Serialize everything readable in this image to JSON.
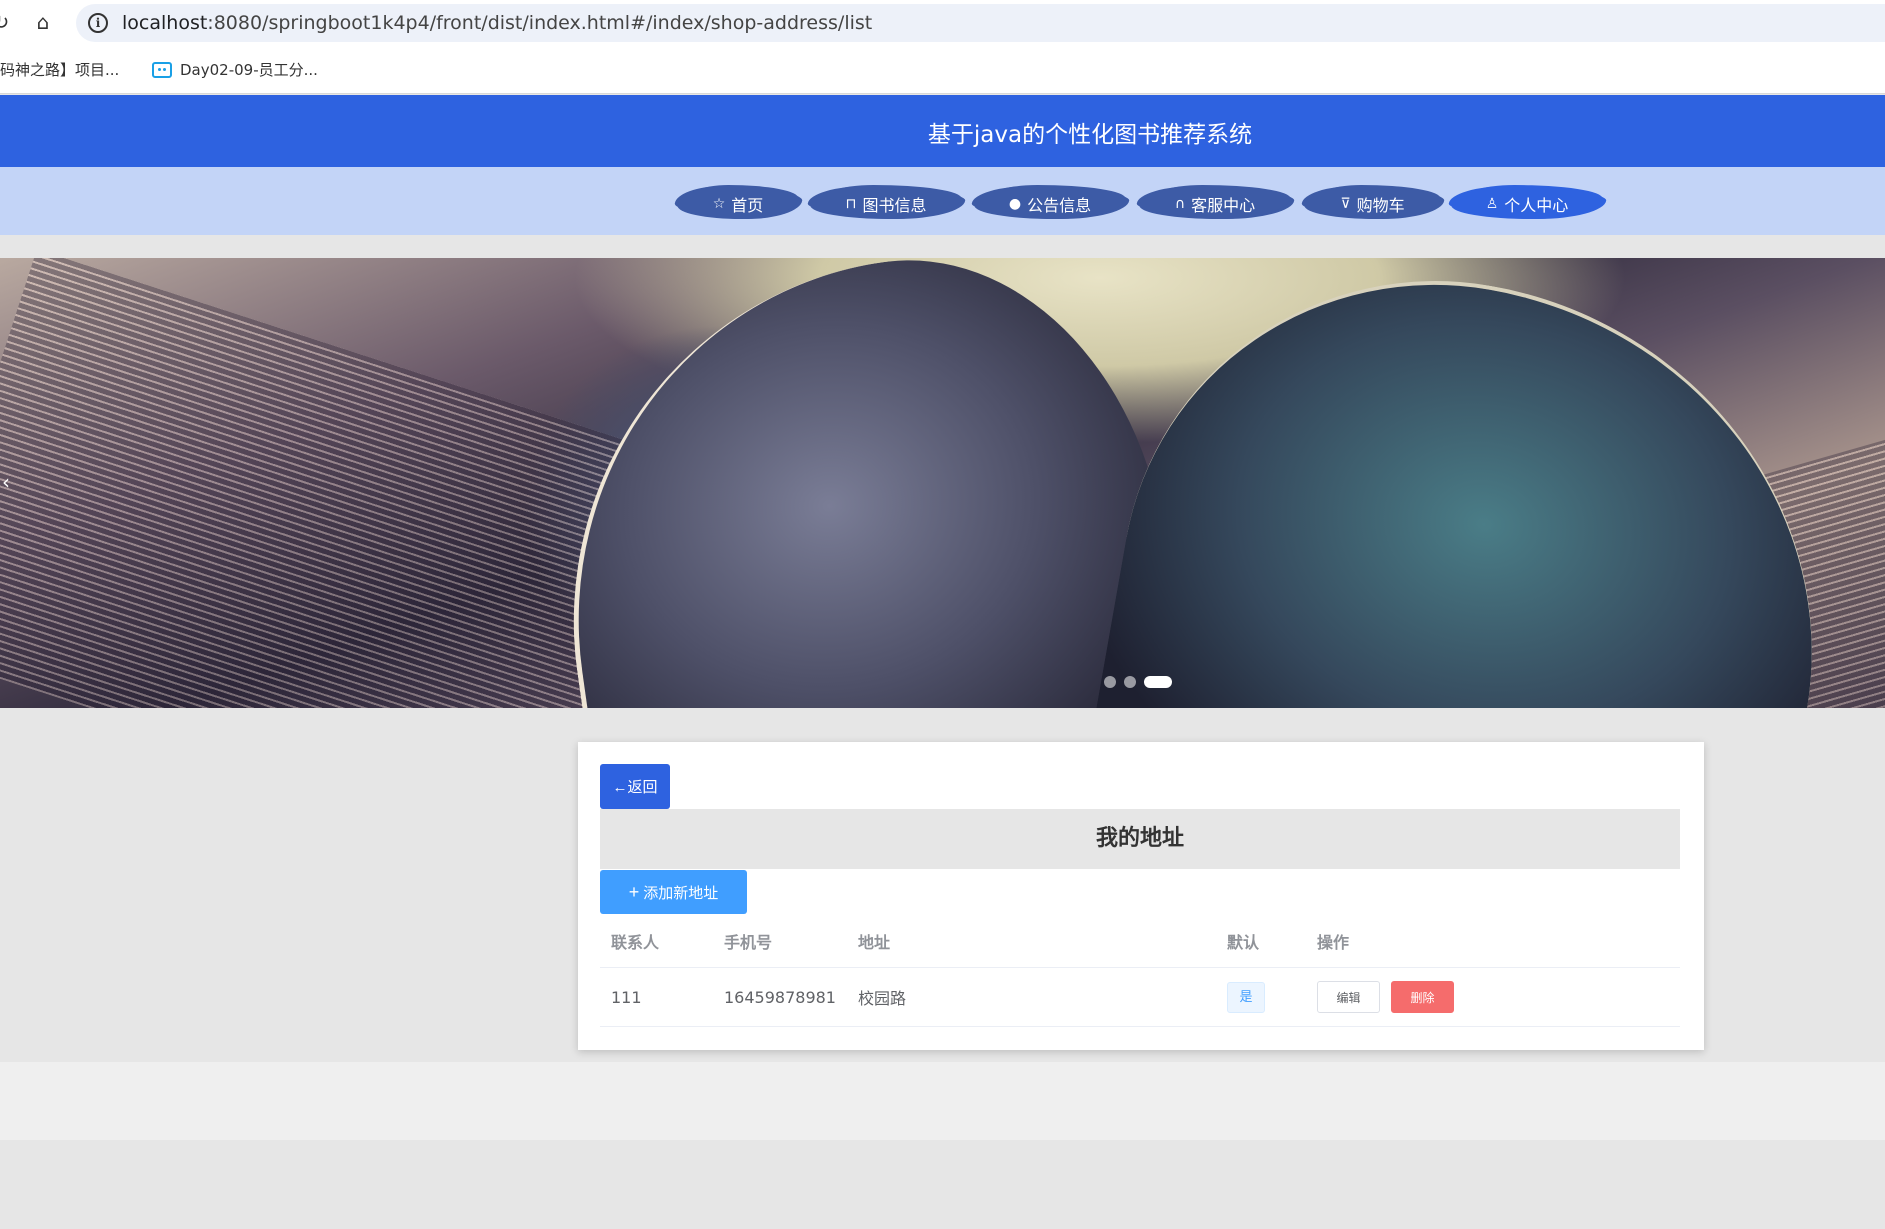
{
  "browser": {
    "url_host": "localhost",
    "url_path": ":8080/springboot1k4p4/front/dist/index.html#/index/shop-address/list",
    "bookmarks": [
      {
        "label": "码神之路】项目..."
      },
      {
        "label": "Day02-09-员工分..."
      }
    ]
  },
  "site": {
    "title": "基于java的个性化图书推荐系统",
    "menu": [
      {
        "label": "首页",
        "icon": "star-icon"
      },
      {
        "label": "图书信息",
        "icon": "bag-icon"
      },
      {
        "label": "公告信息",
        "icon": "alert-circle-icon"
      },
      {
        "label": "客服中心",
        "icon": "headset-icon"
      },
      {
        "label": "购物车",
        "icon": "cart-icon"
      },
      {
        "label": "个人中心",
        "icon": "user-icon",
        "active": true
      }
    ]
  },
  "banner": {
    "slides": 3,
    "active_slide": 3
  },
  "address_page": {
    "back_label": "←返回",
    "title": "我的地址",
    "add_label": "添加新地址",
    "columns": [
      "联系人",
      "手机号",
      "地址",
      "默认",
      "操作"
    ],
    "rows": [
      {
        "contact": "111",
        "phone": "16459878981",
        "address": "校园路",
        "is_default": "是",
        "edit_label": "编辑",
        "delete_label": "删除"
      }
    ]
  },
  "colors": {
    "header_bg": "#2e62e0",
    "menu_bg": "#c3d4f7",
    "primary": "#409eff",
    "danger": "#f56c6c"
  }
}
